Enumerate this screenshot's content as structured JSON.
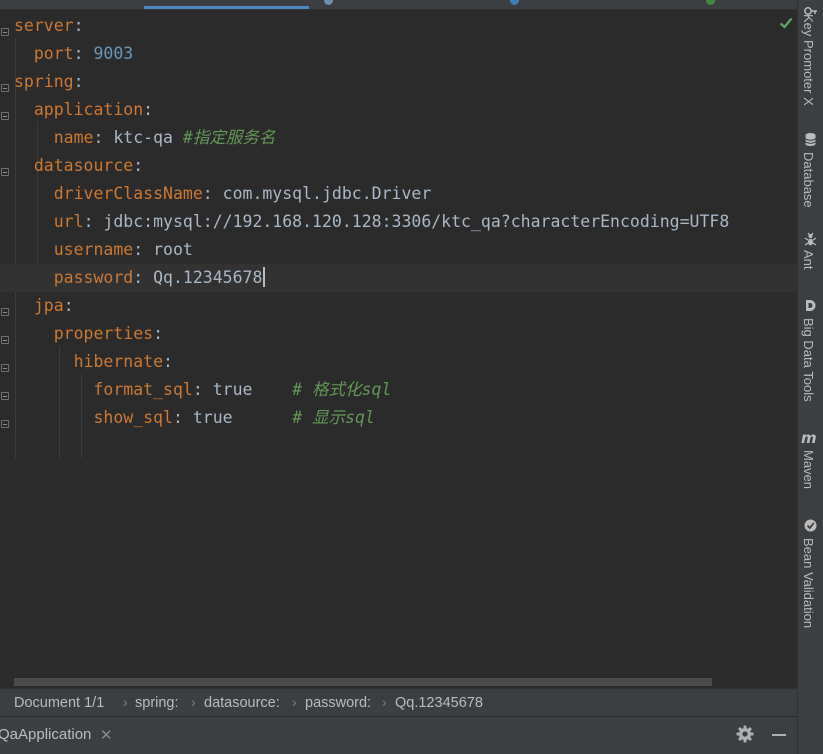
{
  "editor": {
    "lines": [
      {
        "indent": "",
        "key": "server",
        "sep": ":",
        "value": "",
        "vclass": "",
        "comment": ""
      },
      {
        "indent": "  ",
        "key": "port",
        "sep": ":",
        "value": " 9003",
        "vclass": "n",
        "comment": ""
      },
      {
        "indent": "",
        "key": "spring",
        "sep": ":",
        "value": "",
        "vclass": "",
        "comment": ""
      },
      {
        "indent": "  ",
        "key": "application",
        "sep": ":",
        "value": "",
        "vclass": "",
        "comment": ""
      },
      {
        "indent": "    ",
        "key": "name",
        "sep": ":",
        "value": " ktc-qa ",
        "vclass": "s",
        "comment": "#指定服务名"
      },
      {
        "indent": "  ",
        "key": "datasource",
        "sep": ":",
        "value": "",
        "vclass": "",
        "comment": ""
      },
      {
        "indent": "    ",
        "key": "driverClassName",
        "sep": ":",
        "value": " com.mysql.jdbc.Driver",
        "vclass": "s",
        "comment": ""
      },
      {
        "indent": "    ",
        "key": "url",
        "sep": ":",
        "value": " jdbc:mysql://192.168.120.128:3306/ktc_qa?characterEncoding=UTF8",
        "vclass": "s",
        "comment": ""
      },
      {
        "indent": "    ",
        "key": "username",
        "sep": ":",
        "value": " root",
        "vclass": "s",
        "comment": ""
      },
      {
        "indent": "    ",
        "key": "password",
        "sep": ":",
        "value": " Qq.12345678",
        "vclass": "s",
        "comment": ""
      },
      {
        "indent": "  ",
        "key": "jpa",
        "sep": ":",
        "value": "",
        "vclass": "",
        "comment": ""
      },
      {
        "indent": "    ",
        "key": "properties",
        "sep": ":",
        "value": "",
        "vclass": "",
        "comment": ""
      },
      {
        "indent": "      ",
        "key": "hibernate",
        "sep": ":",
        "value": "",
        "vclass": "",
        "comment": ""
      },
      {
        "indent": "        ",
        "key": "format_sql",
        "sep": ":",
        "value": " true    ",
        "vclass": "s",
        "comment": "# 格式化sql"
      },
      {
        "indent": "        ",
        "key": "show_sql",
        "sep": ":",
        "value": " true      ",
        "vclass": "s",
        "comment": "# 显示sql"
      }
    ],
    "current_line": 9
  },
  "breadcrumb": {
    "document": "Document 1/1",
    "spring": "spring:",
    "datasource": "datasource:",
    "password": "password:",
    "value": "Qq.12345678"
  },
  "run": {
    "tab_label": "QaApplication",
    "close_glyph": "✕"
  },
  "tools": [
    {
      "label": "Key Promoter X",
      "icon": "key-promoter-icon"
    },
    {
      "label": "Database",
      "icon": "database-icon"
    },
    {
      "label": "Ant",
      "icon": "ant-icon"
    },
    {
      "label": "Big Data Tools",
      "icon": "big-data-tools-icon"
    },
    {
      "label": "Maven",
      "icon": "maven-icon"
    },
    {
      "label": "Bean Validation",
      "icon": "bean-validation-icon"
    }
  ],
  "colors": {
    "keyword": "#cc7832",
    "number": "#6897bb",
    "comment": "#629755",
    "accent": "#4a88c7",
    "ok": "#59a869"
  }
}
